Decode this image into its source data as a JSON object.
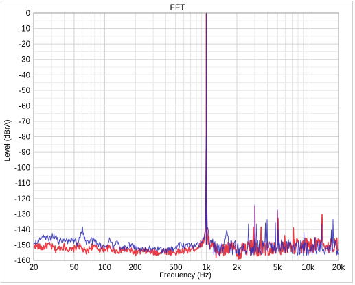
{
  "chart_data": {
    "type": "line",
    "title": "FFT",
    "xlabel": "Frequency (Hz)",
    "ylabel": "Level (dBrA)",
    "x_scale": "log",
    "xlim": [
      20,
      20000
    ],
    "ylim": [
      -160,
      0
    ],
    "grid": true,
    "x_ticks": [
      {
        "v": 20,
        "label": "20"
      },
      {
        "v": 50,
        "label": "50"
      },
      {
        "v": 100,
        "label": "100"
      },
      {
        "v": 200,
        "label": "200"
      },
      {
        "v": 500,
        "label": "500"
      },
      {
        "v": 1000,
        "label": "1k"
      },
      {
        "v": 2000,
        "label": "2k"
      },
      {
        "v": 5000,
        "label": "5k"
      },
      {
        "v": 10000,
        "label": "10k"
      },
      {
        "v": 20000,
        "label": "20k"
      }
    ],
    "y_ticks": [
      0,
      -10,
      -20,
      -30,
      -40,
      -50,
      -60,
      -70,
      -80,
      -90,
      -100,
      -110,
      -120,
      -130,
      -140,
      -150,
      -160
    ],
    "series": [
      {
        "color": "#e8323c",
        "x": [
          20,
          24,
          28,
          33,
          40,
          47,
          55,
          65,
          75,
          90,
          110,
          130,
          160,
          200,
          250,
          320,
          400,
          500,
          600,
          700,
          800,
          900,
          960,
          985,
          995,
          1000,
          1005,
          1015,
          1040,
          1100,
          1200,
          1400,
          1700,
          2000,
          2500,
          2999,
          3000,
          3001,
          3500,
          4000,
          4999,
          5000,
          5001,
          6000,
          7000,
          8000,
          10000,
          12000,
          15000,
          20000
        ],
        "y": [
          -150,
          -152,
          -150,
          -153,
          -151,
          -154,
          -150,
          -155,
          -151,
          -153,
          -152,
          -154,
          -153,
          -155,
          -154,
          -155,
          -154,
          -155,
          -154,
          -153,
          -152,
          -149,
          -146,
          -138,
          -115,
          0,
          -115,
          -138,
          -146,
          -150,
          -153,
          -154,
          -152,
          -155,
          -152,
          -152,
          -125,
          -152,
          -153,
          -152,
          -152,
          -128,
          -152,
          -151,
          -152,
          -150,
          -151,
          -150,
          -150,
          -150
        ]
      },
      {
        "color": "#2b2bb8",
        "x": [
          20,
          22,
          25,
          28,
          32,
          36,
          40,
          45,
          50,
          55,
          58,
          60,
          62,
          66,
          72,
          80,
          90,
          100,
          110,
          120,
          130,
          150,
          170,
          200,
          240,
          300,
          380,
          450,
          550,
          700,
          850,
          950,
          980,
          992,
          998,
          1000,
          1002,
          1008,
          1020,
          1060,
          1150,
          1300,
          1500,
          1600,
          1700,
          2000,
          2500,
          2999,
          3000,
          3001,
          3500,
          4000,
          4999,
          5000,
          5001,
          6000,
          7000,
          8000,
          10000,
          12000,
          15000,
          20000
        ],
        "y": [
          -149,
          -147,
          -145,
          -146,
          -144,
          -148,
          -146,
          -148,
          -147,
          -149,
          -143,
          -139,
          -143,
          -150,
          -147,
          -148,
          -150,
          -152,
          -147,
          -151,
          -148,
          -153,
          -150,
          -152,
          -153,
          -152,
          -154,
          -153,
          -150,
          -151,
          -150,
          -147,
          -140,
          -125,
          -60,
          0,
          -60,
          -125,
          -140,
          -148,
          -151,
          -153,
          -150,
          -140,
          -152,
          -152,
          -152,
          -152,
          -124,
          -152,
          -152,
          -152,
          -152,
          -127,
          -152,
          -151,
          -152,
          -152,
          -152,
          -152,
          -152,
          -152
        ]
      }
    ]
  }
}
